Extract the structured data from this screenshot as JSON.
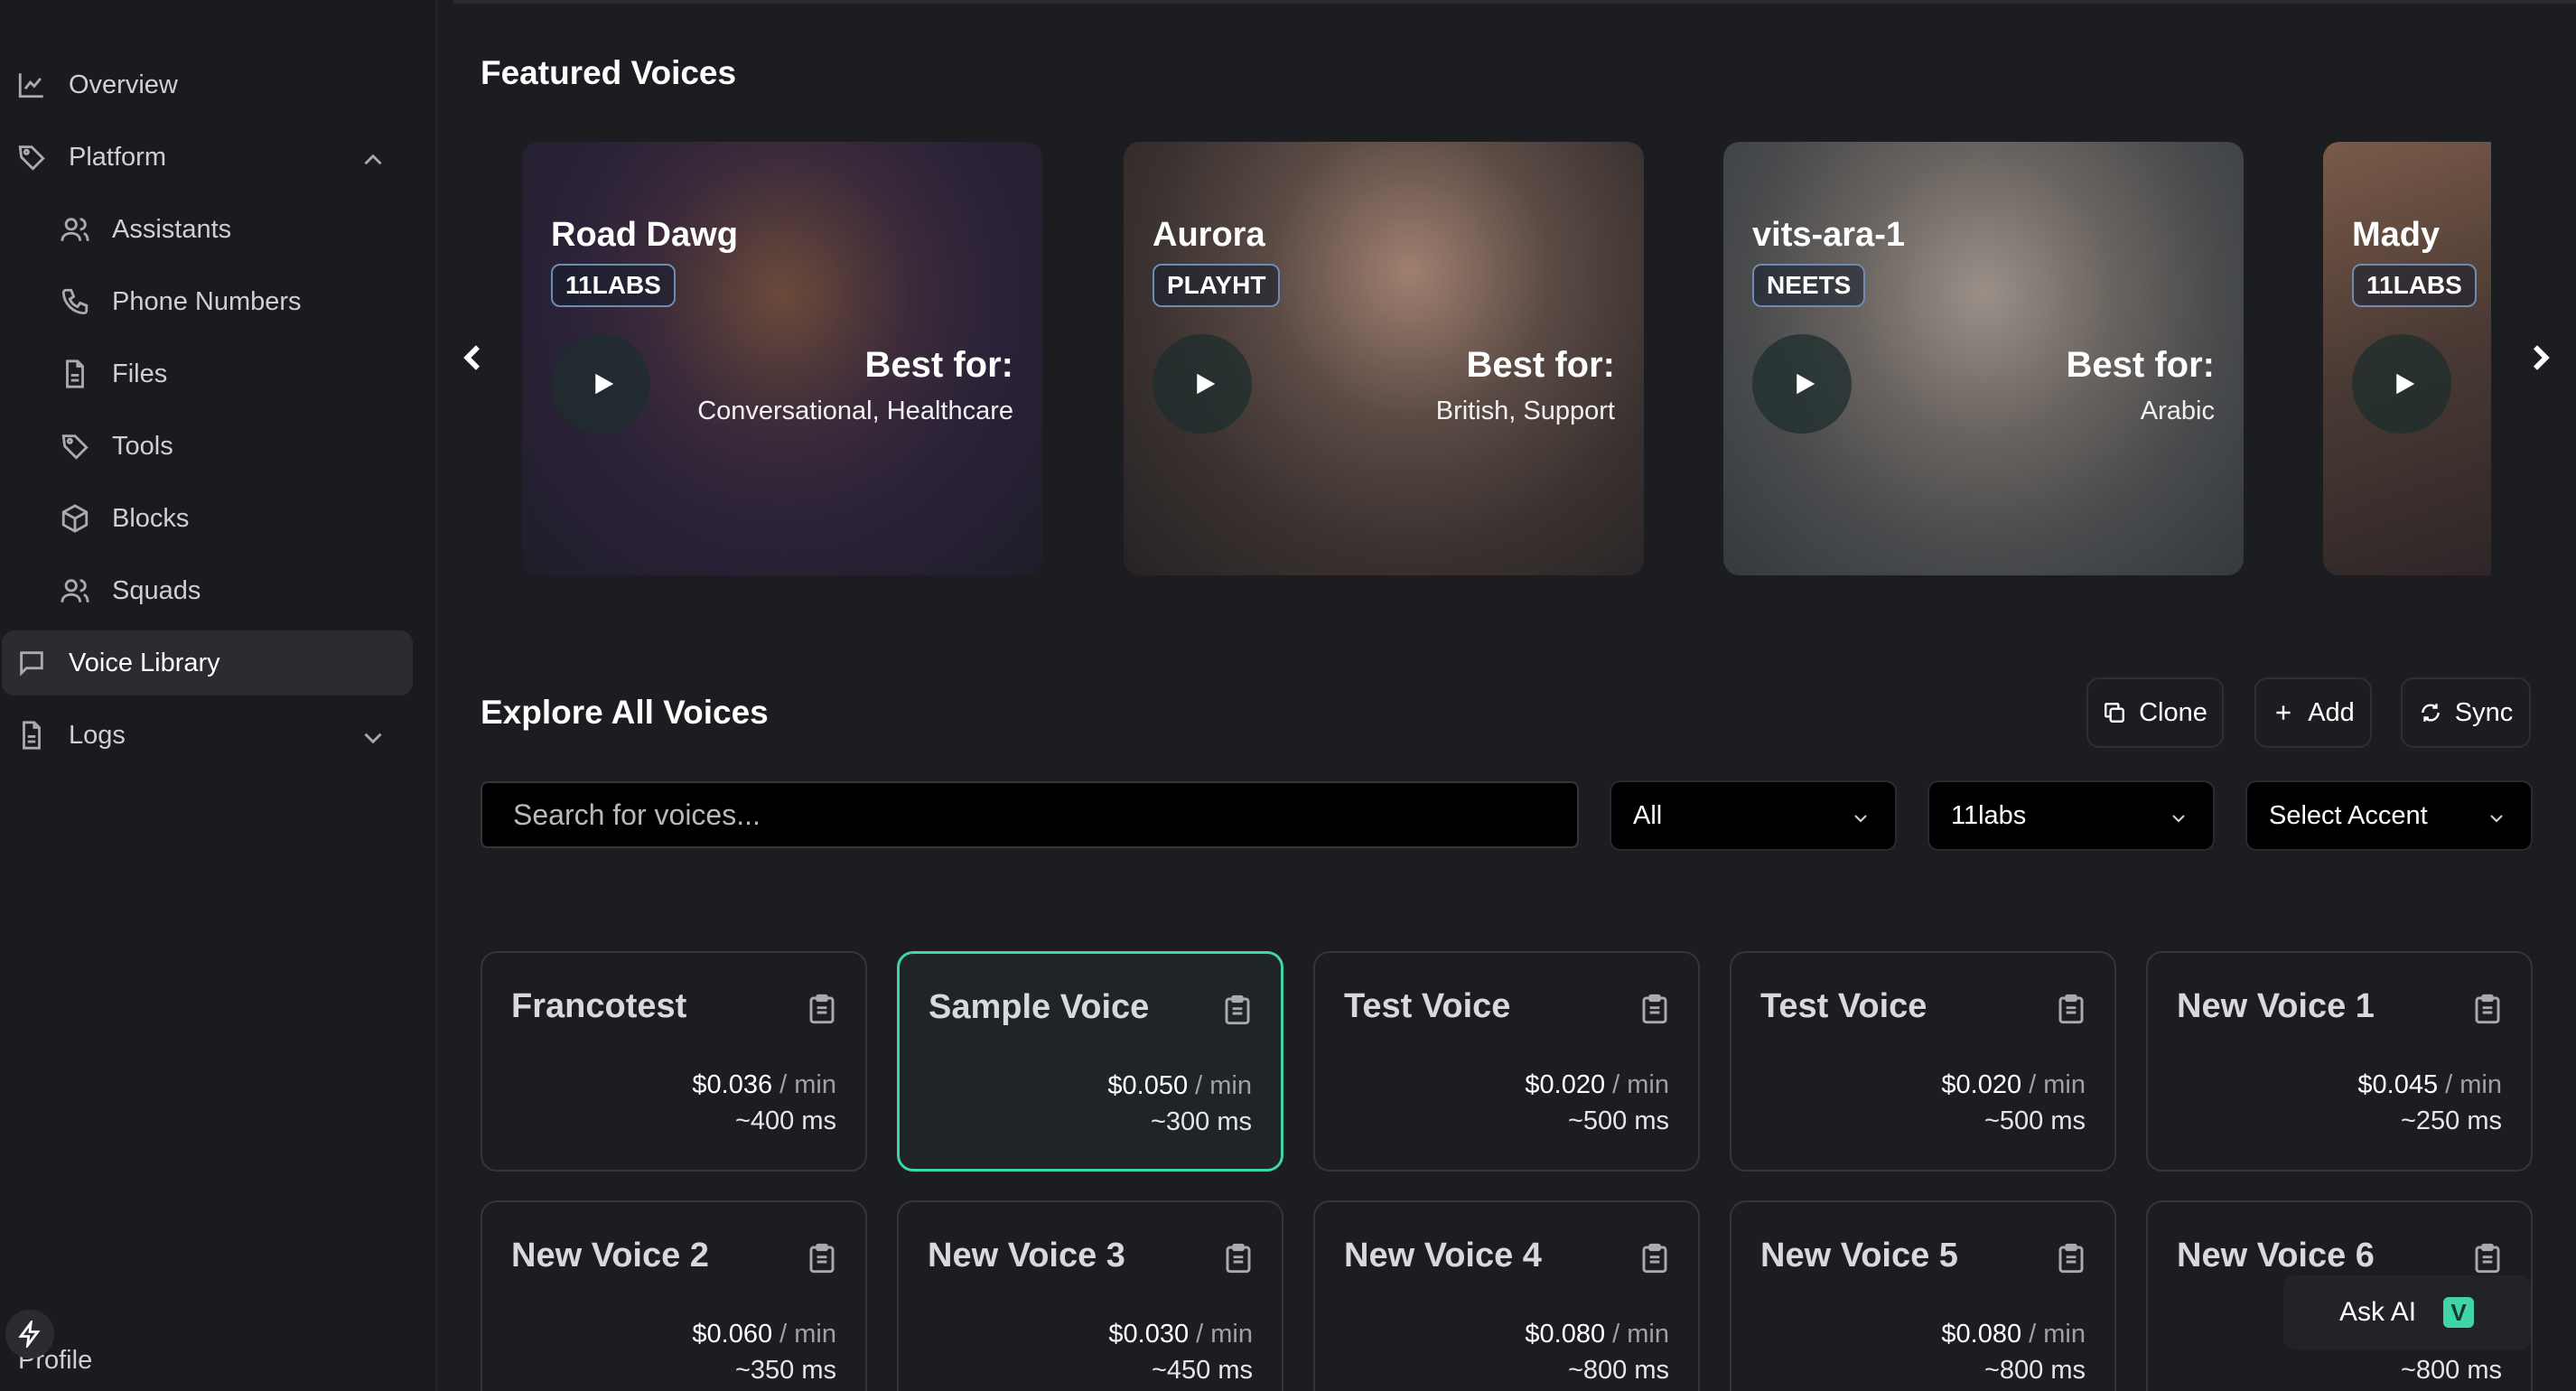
{
  "sidebar": {
    "items": [
      {
        "label": "Overview",
        "icon": "chart-line-icon"
      },
      {
        "label": "Platform",
        "icon": "tag-icon"
      },
      {
        "label": "Assistants",
        "icon": "users-icon"
      },
      {
        "label": "Phone Numbers",
        "icon": "phone-icon"
      },
      {
        "label": "Files",
        "icon": "file-icon"
      },
      {
        "label": "Tools",
        "icon": "tag-icon"
      },
      {
        "label": "Blocks",
        "icon": "box-icon"
      },
      {
        "label": "Squads",
        "icon": "users-icon"
      },
      {
        "label": "Voice Library",
        "icon": "chat-icon"
      },
      {
        "label": "Logs",
        "icon": "file-icon"
      }
    ],
    "profile_label": "Profile"
  },
  "featured": {
    "title": "Featured Voices",
    "best_for_label": "Best for:",
    "cards": [
      {
        "name": "Road Dawg",
        "provider": "11LABS",
        "tags": "Conversational, Healthcare"
      },
      {
        "name": "Aurora",
        "provider": "PLAYHT",
        "tags": "British, Support"
      },
      {
        "name": "vits-ara-1",
        "provider": "NEETS",
        "tags": "Arabic"
      },
      {
        "name": "Mady",
        "provider": "11LABS",
        "tags": ""
      }
    ]
  },
  "explore": {
    "title": "Explore All Voices",
    "clone_label": "Clone",
    "add_label": "Add",
    "sync_label": "Sync",
    "search_placeholder": "Search for voices...",
    "filter_gender": "All",
    "filter_provider": "11labs",
    "filter_accent": "Select Accent"
  },
  "voices": [
    {
      "name": "Francotest",
      "price": "$0.036",
      "unit": "/ min",
      "latency": "~400 ms"
    },
    {
      "name": "Sample Voice",
      "price": "$0.050",
      "unit": "/ min",
      "latency": "~300 ms"
    },
    {
      "name": "Test Voice",
      "price": "$0.020",
      "unit": "/ min",
      "latency": "~500 ms"
    },
    {
      "name": "Test Voice",
      "price": "$0.020",
      "unit": "/ min",
      "latency": "~500 ms"
    },
    {
      "name": "New Voice 1",
      "price": "$0.045",
      "unit": "/ min",
      "latency": "~250 ms"
    },
    {
      "name": "New Voice 2",
      "price": "$0.060",
      "unit": "/ min",
      "latency": "~350 ms"
    },
    {
      "name": "New Voice 3",
      "price": "$0.030",
      "unit": "/ min",
      "latency": "~450 ms"
    },
    {
      "name": "New Voice 4",
      "price": "$0.080",
      "unit": "/ min",
      "latency": "~800 ms"
    },
    {
      "name": "New Voice 5",
      "price": "$0.080",
      "unit": "/ min",
      "latency": "~800 ms"
    },
    {
      "name": "New Voice 6",
      "price": "",
      "unit": "",
      "latency": "~800 ms"
    }
  ],
  "ask_ai": {
    "label": "Ask AI",
    "logo": "V"
  },
  "colors": {
    "accent": "#3fd5a8",
    "background": "#1c1d21",
    "sidebar": "#1a1b1f"
  }
}
